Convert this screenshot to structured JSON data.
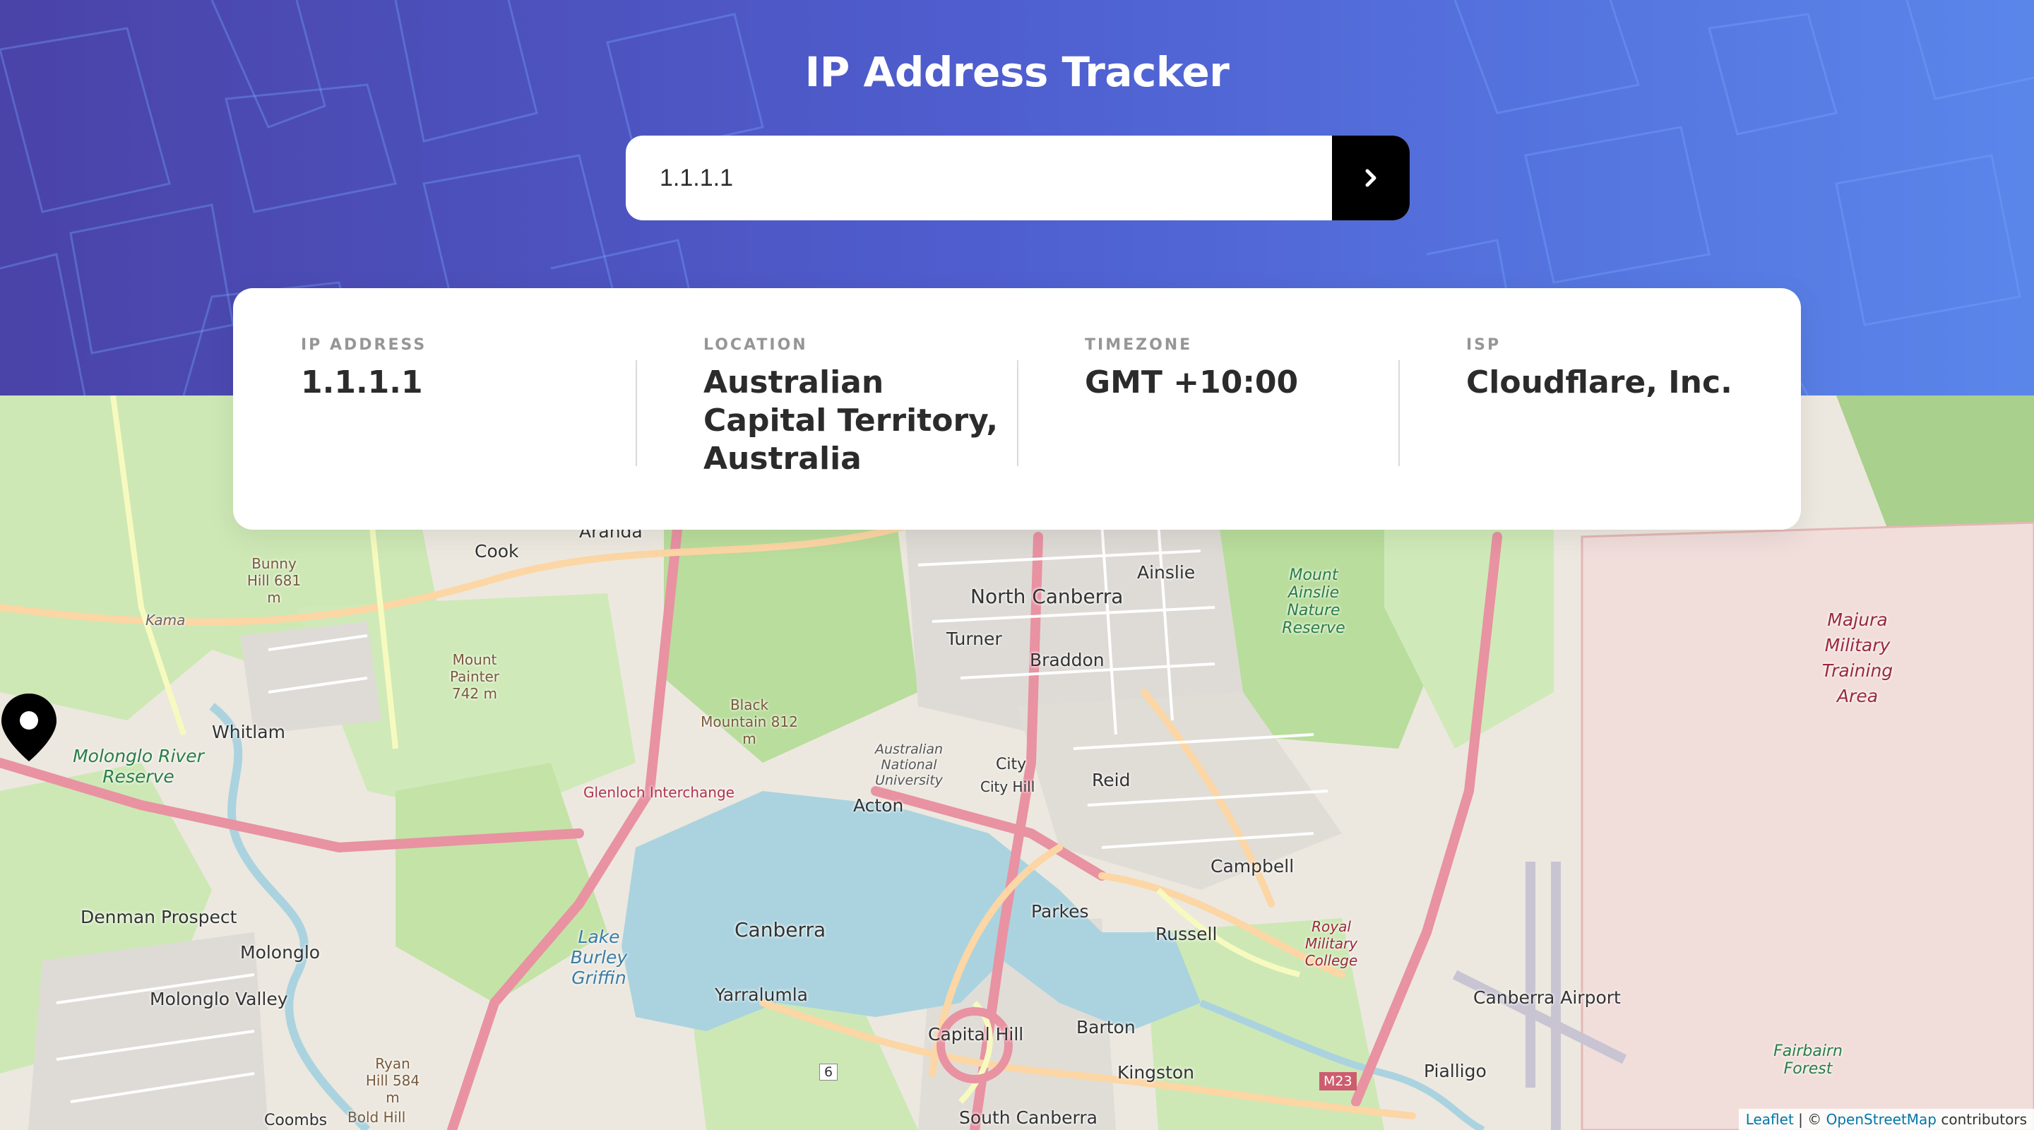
{
  "app": {
    "title": "IP Address Tracker"
  },
  "search": {
    "value": "1.1.1.1",
    "submit_icon": "chevron-right-icon"
  },
  "info": {
    "ip": {
      "label": "IP ADDRESS",
      "value": "1.1.1.1"
    },
    "location": {
      "label": "LOCATION",
      "value": "Australian Capital Territory, Australia"
    },
    "timezone": {
      "label": "TIMEZONE",
      "value": "GMT +10:00"
    },
    "isp": {
      "label": "ISP",
      "value": "Cloudflare, Inc."
    }
  },
  "map": {
    "marker_icon": "location-pin-icon",
    "labels": {
      "aranda": "Aranda",
      "cook": "Cook",
      "ainslie": "Ainslie",
      "north_canberra": "North Canberra",
      "turner": "Turner",
      "braddon": "Braddon",
      "city": "City",
      "city_hill": "City Hill",
      "reid": "Reid",
      "acton": "Acton",
      "campbell": "Campbell",
      "parkes": "Parkes",
      "russell": "Russell",
      "canberra": "Canberra",
      "yarralumla": "Yarralumla",
      "capital_hill": "Capital Hill",
      "barton": "Barton",
      "kingston": "Kingston",
      "south_canberra": "South Canberra",
      "canberra_airport": "Canberra Airport",
      "pialligo": "Pialligo",
      "whitlam": "Whitlam",
      "denman_prospect": "Denman Prospect",
      "molonglo": "Molonglo",
      "molonglo_valley": "Molonglo Valley",
      "coombs": "Coombs",
      "molonglo_river_reserve": "Molonglo River Reserve",
      "majura": "Majura Military Training Area",
      "royal_military_college": "Royal Military College",
      "mount_ainslie": "Mount Ainslie Nature Reserve",
      "black_mountain": "Black Mountain 812 m",
      "bunny_hill": "Bunny Hill 681 m",
      "mount_painter": "Mount Painter 742 m",
      "ryan_hill": "Ryan Hill 584 m",
      "bold_hill": "Bold Hill",
      "fairbairn_forest": "Fairbairn Forest",
      "lake_burley_griffin": "Lake Burley Griffin",
      "glenloch": "Glenloch Interchange",
      "anu": "Australian National University",
      "kama": "Kama",
      "m23": "M23",
      "route6": "6"
    },
    "attribution": {
      "leaflet": "Leaflet",
      "separator": " | © ",
      "osm": "OpenStreetMap",
      "suffix": " contributors"
    }
  }
}
